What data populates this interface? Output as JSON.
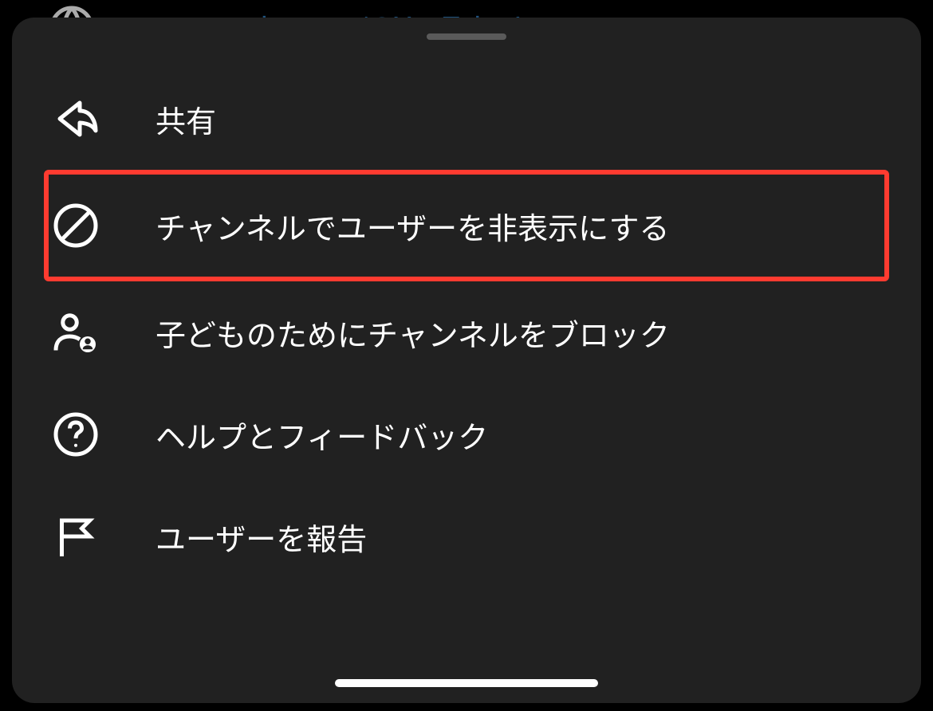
{
  "background": {
    "url_text": "www.youtube.com/@YouTubeJapan"
  },
  "menu": {
    "items": [
      {
        "id": "share",
        "label": "共有",
        "icon": "share-icon"
      },
      {
        "id": "hide-user",
        "label": "チャンネルでユーザーを非表示にする",
        "icon": "block-icon",
        "highlighted": true
      },
      {
        "id": "block-for-kids",
        "label": "子どものためにチャンネルをブロック",
        "icon": "person-block-icon"
      },
      {
        "id": "help",
        "label": "ヘルプとフィードバック",
        "icon": "help-icon"
      },
      {
        "id": "report",
        "label": "ユーザーを報告",
        "icon": "flag-icon"
      }
    ]
  }
}
